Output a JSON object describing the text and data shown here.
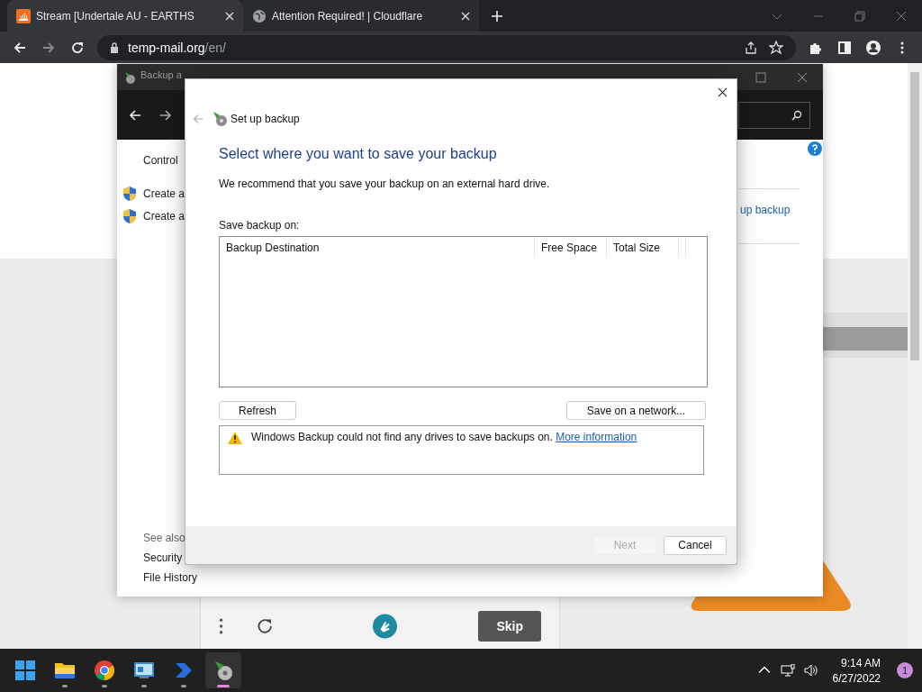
{
  "browser": {
    "tabs": [
      {
        "title": "Stream [Undertale AU - EARTHS",
        "kind": "music",
        "selected": true
      },
      {
        "title": "Attention Required! | Cloudflare",
        "kind": "globe",
        "selected": false
      }
    ],
    "url": {
      "host": "temp-mail.org",
      "path": "/en/"
    }
  },
  "captcha": {
    "skip": "Skip"
  },
  "backup_window": {
    "title": "Backup a",
    "breadcrumb": "Control",
    "tasks": [
      "Create a",
      "Create a"
    ],
    "see_also": "See also",
    "links": [
      "Security",
      "File History"
    ],
    "right_link": "up backup"
  },
  "dialog": {
    "title": "Set up backup",
    "heading": "Select where you want to save your backup",
    "intro": "We recommend that you save your backup on an external hard drive.",
    "list_label": "Save backup on:",
    "columns": [
      "Backup Destination",
      "Free Space",
      "Total Size"
    ],
    "refresh": "Refresh",
    "network": "Save on a network...",
    "message": "Windows Backup could not find any drives to save backups on.",
    "message_link": "More information",
    "buttons": [
      {
        "label": "Next",
        "disabled": true
      },
      {
        "label": "Cancel",
        "disabled": false
      }
    ]
  },
  "taskbar": {
    "apps": [
      {
        "kind": "start",
        "running": false,
        "selected": false
      },
      {
        "kind": "folder",
        "running": true,
        "selected": false
      },
      {
        "kind": "chrome",
        "running": true,
        "selected": false
      },
      {
        "kind": "control",
        "running": true,
        "selected": false
      },
      {
        "kind": "arrow",
        "running": true,
        "selected": false
      },
      {
        "kind": "backup",
        "running": true,
        "selected": true
      }
    ],
    "time": "9:14 AM",
    "date": "6/27/2022",
    "notifications": "1"
  }
}
